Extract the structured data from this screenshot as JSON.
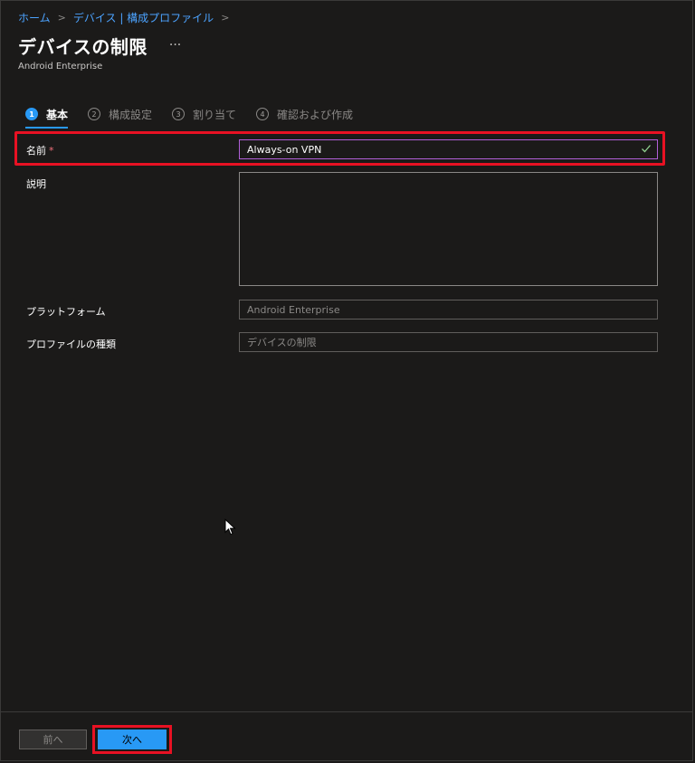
{
  "breadcrumb": {
    "items": [
      "ホーム",
      "デバイス | 構成プロファイル"
    ]
  },
  "header": {
    "title": "デバイスの制限",
    "more_label": "···",
    "subtitle": "Android Enterprise"
  },
  "steps": [
    {
      "num": "1",
      "label": "基本",
      "active": true
    },
    {
      "num": "2",
      "label": "構成設定",
      "active": false
    },
    {
      "num": "3",
      "label": "割り当て",
      "active": false
    },
    {
      "num": "4",
      "label": "確認および作成",
      "active": false
    }
  ],
  "form": {
    "name_label": "名前",
    "name_required": "*",
    "name_value": "Always-on VPN",
    "description_label": "説明",
    "description_value": "",
    "platform_label": "プラットフォーム",
    "platform_value": "Android Enterprise",
    "profile_type_label": "プロファイルの種類",
    "profile_type_value": "デバイスの制限"
  },
  "footer": {
    "prev_label": "前へ",
    "next_label": "次へ"
  },
  "colors": {
    "accent": "#2899f5",
    "link": "#4ca3ff",
    "highlight": "#e81123",
    "focus_border": "#b15fd8"
  }
}
